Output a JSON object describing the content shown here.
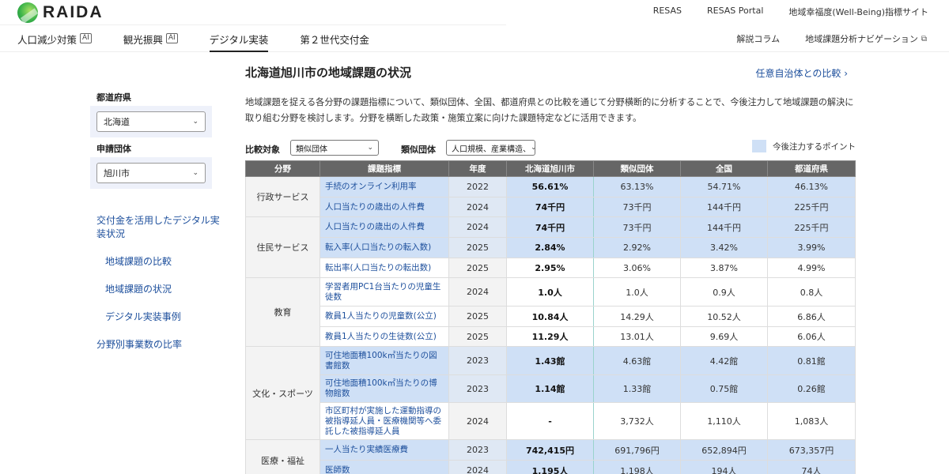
{
  "header": {
    "logo_text": "RAIDA",
    "top_links": [
      "RESAS",
      "RESAS Portal",
      "地域幸福度(Well-Being)指標サイト"
    ],
    "nav": [
      {
        "label": "人口減少対策",
        "badge": "AI",
        "active": false
      },
      {
        "label": "観光振興",
        "badge": "AI",
        "active": false
      },
      {
        "label": "デジタル実装",
        "badge": "",
        "active": true
      },
      {
        "label": "第２世代交付金",
        "badge": "",
        "active": false
      }
    ],
    "sub_links": [
      {
        "label": "解説コラム",
        "icon": ""
      },
      {
        "label": "地域課題分析ナビゲーション",
        "icon": "external-link-icon"
      }
    ]
  },
  "sidebar": {
    "prefecture_label": "都道府県",
    "prefecture_value": "北海道",
    "org_label": "申請団体",
    "org_value": "旭川市",
    "menu": [
      {
        "label": "交付金を活用したデジタル実装状況",
        "indent": false
      },
      {
        "label": "地域課題の比較",
        "indent": true
      },
      {
        "label": "地域課題の状況",
        "indent": true
      },
      {
        "label": "デジタル実装事例",
        "indent": true
      },
      {
        "label": "分野別事業数の比率",
        "indent": false
      }
    ]
  },
  "main": {
    "title": "北海道旭川市の地域課題の状況",
    "compare_link": "任意自治体との比較",
    "description": "地域課題を捉える各分野の課題指標について、類似団体、全国、都道府県との比較を通じて分野横断的に分析することで、今後注力して地域課題の解決に取り組む分野を検討します。分野を横断した政策・施策立案に向けた課題特定などに活用できます。",
    "filters": {
      "compare_label": "比較対象",
      "compare_value": "類似団体",
      "similar_label": "類似団体",
      "similar_value": "人口規模、産業構造、"
    },
    "legend_label": "今後注力するポイント",
    "highlight_color": "#cfe0f6"
  },
  "table": {
    "headers": [
      "分野",
      "課題指標",
      "年度",
      "北海道旭川市",
      "類似団体",
      "全国",
      "都道府県"
    ],
    "groups": [
      {
        "field": "行政サービス",
        "rows": [
          {
            "indicator": "手続のオンライン利用率",
            "year": "2022",
            "city": "56.61%",
            "similar": "63.13%",
            "national": "54.71%",
            "pref": "46.13%",
            "highlight": true
          },
          {
            "indicator": "人口当たりの歳出の人件費",
            "year": "2024",
            "city": "74千円",
            "similar": "73千円",
            "national": "144千円",
            "pref": "225千円",
            "highlight": true
          }
        ]
      },
      {
        "field": "住民サービス",
        "rows": [
          {
            "indicator": "人口当たりの歳出の人件費",
            "year": "2024",
            "city": "74千円",
            "similar": "73千円",
            "national": "144千円",
            "pref": "225千円",
            "highlight": true
          },
          {
            "indicator": "転入率(人口当たりの転入数)",
            "year": "2025",
            "city": "2.84%",
            "similar": "2.92%",
            "national": "3.42%",
            "pref": "3.99%",
            "highlight": true
          },
          {
            "indicator": "転出率(人口当たりの転出数)",
            "year": "2025",
            "city": "2.95%",
            "similar": "3.06%",
            "national": "3.87%",
            "pref": "4.99%",
            "highlight": false
          }
        ]
      },
      {
        "field": "教育",
        "rows": [
          {
            "indicator": "学習者用PC1台当たりの児童生徒数",
            "year": "2024",
            "city": "1.0人",
            "similar": "1.0人",
            "national": "0.9人",
            "pref": "0.8人",
            "highlight": false
          },
          {
            "indicator": "教員1人当たりの児童数(公立)",
            "year": "2025",
            "city": "10.84人",
            "similar": "14.29人",
            "national": "10.52人",
            "pref": "6.86人",
            "highlight": false
          },
          {
            "indicator": "教員1人当たりの生徒数(公立)",
            "year": "2025",
            "city": "11.29人",
            "similar": "13.01人",
            "national": "9.69人",
            "pref": "6.06人",
            "highlight": false
          }
        ]
      },
      {
        "field": "文化・スポーツ",
        "rows": [
          {
            "indicator": "可住地面積100k㎡当たりの図書館数",
            "year": "2023",
            "city": "1.43館",
            "similar": "4.63館",
            "national": "4.42館",
            "pref": "0.81館",
            "highlight": true
          },
          {
            "indicator": "可住地面積100k㎡当たりの博物館数",
            "year": "2023",
            "city": "1.14館",
            "similar": "1.33館",
            "national": "0.75館",
            "pref": "0.26館",
            "highlight": true
          },
          {
            "indicator": "市区町村が実施した運動指導の被指導延人員・医療機関等へ委託した被指導延人員",
            "year": "2024",
            "city": "-",
            "similar": "3,732人",
            "national": "1,110人",
            "pref": "1,083人",
            "highlight": false
          }
        ]
      },
      {
        "field": "医療・福祉",
        "rows": [
          {
            "indicator": "一人当たり実績医療費",
            "year": "2023",
            "city": "742,415円",
            "similar": "691,796円",
            "national": "652,894円",
            "pref": "673,357円",
            "highlight": true
          },
          {
            "indicator": "医師数",
            "year": "2024",
            "city": "1,195人",
            "similar": "1,198人",
            "national": "194人",
            "pref": "74人",
            "highlight": true
          }
        ]
      }
    ]
  }
}
